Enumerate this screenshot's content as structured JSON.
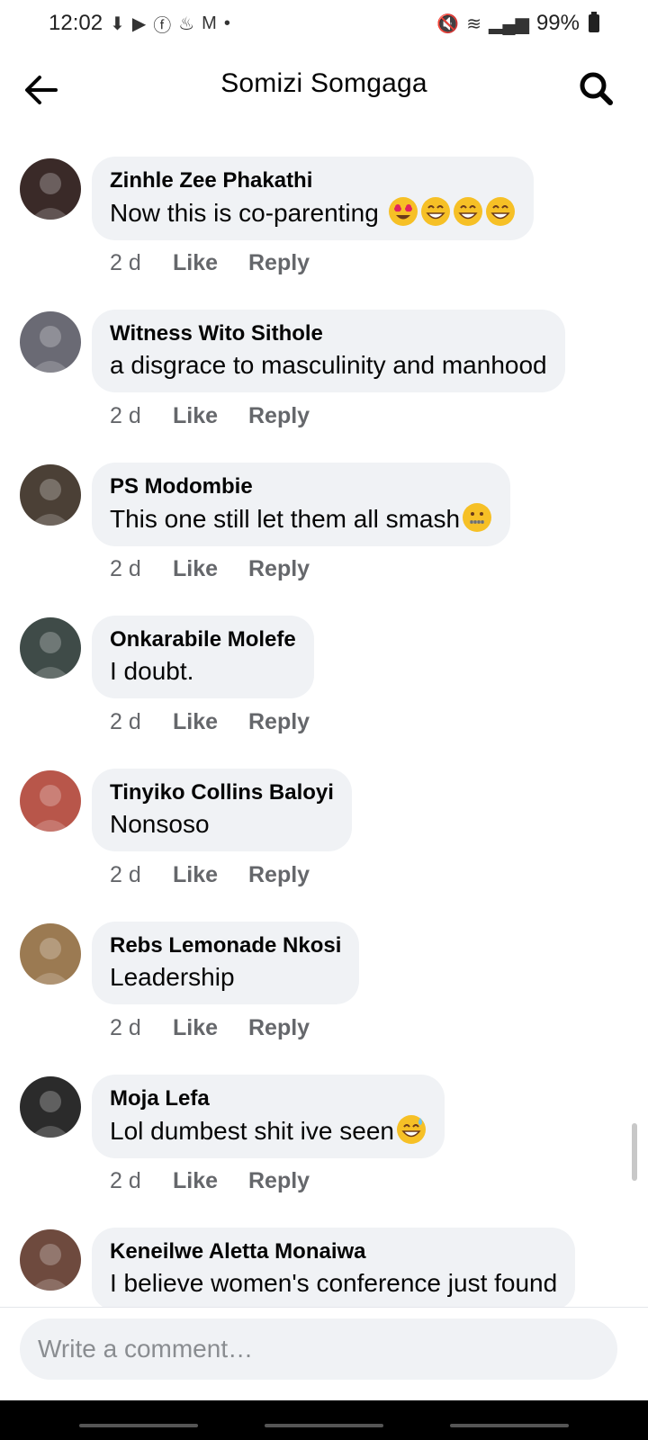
{
  "status_bar": {
    "time": "12:02",
    "battery": "99%",
    "left_icons": [
      "download-icon",
      "youtube-icon",
      "facebook-icon",
      "notification-icon",
      "gmail-icon",
      "dot-icon"
    ],
    "right_icons": [
      "mute-icon",
      "wifi-icon",
      "signal-icon",
      "battery-icon"
    ]
  },
  "header": {
    "title": "Somizi Somgaga"
  },
  "comments": [
    {
      "author": "Zinhle Zee Phakathi",
      "text": "Now this is co-parenting ",
      "emojis": [
        "heart-eyes",
        "grin",
        "grin",
        "grin"
      ],
      "time": "2 d",
      "like": "Like",
      "reply": "Reply",
      "avatar_color": "#3a2a28"
    },
    {
      "author": "Witness Wito Sithole",
      "text": "a disgrace to masculinity and  manhood",
      "emojis": [],
      "time": "2 d",
      "like": "Like",
      "reply": "Reply",
      "avatar_color": "#6a6a74"
    },
    {
      "author": "PS Modombie",
      "text": "This one still let them all smash",
      "emojis": [
        "zipper-mouth"
      ],
      "time": "2 d",
      "like": "Like",
      "reply": "Reply",
      "avatar_color": "#4b4036"
    },
    {
      "author": "Onkarabile Molefe",
      "text": "I doubt.",
      "emojis": [],
      "time": "2 d",
      "like": "Like",
      "reply": "Reply",
      "avatar_color": "#3f4b48"
    },
    {
      "author": "Tinyiko Collins Baloyi",
      "text": "Nonsoso",
      "emojis": [],
      "time": "2 d",
      "like": "Like",
      "reply": "Reply",
      "avatar_color": "#b8564a"
    },
    {
      "author": "Rebs Lemonade Nkosi",
      "text": "Leadership",
      "emojis": [],
      "time": "2 d",
      "like": "Like",
      "reply": "Reply",
      "avatar_color": "#9b7a52"
    },
    {
      "author": "Moja Lefa",
      "text": "Lol dumbest shit ive seen",
      "emojis": [
        "sweat-smile"
      ],
      "time": "2 d",
      "like": "Like",
      "reply": "Reply",
      "avatar_color": "#2b2b2b"
    },
    {
      "author": "Keneilwe Aletta Monaiwa",
      "text": "I believe women's conference just found",
      "emojis": [],
      "time": "",
      "like": "",
      "reply": "",
      "avatar_color": "#6e4a3e"
    }
  ],
  "composer": {
    "placeholder": "Write a comment…"
  }
}
